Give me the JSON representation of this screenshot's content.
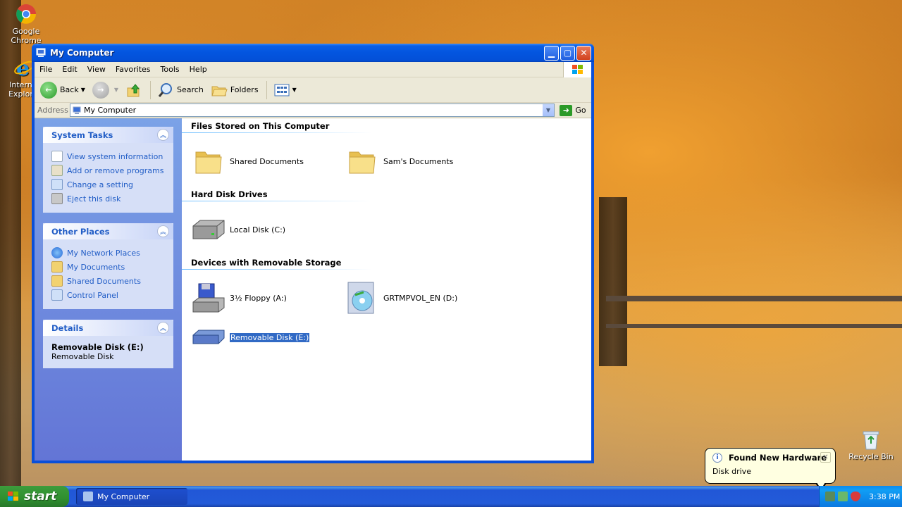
{
  "desktop": {
    "icons": [
      {
        "label": "Google Chrome",
        "icon": "chrome-icon"
      },
      {
        "label": "Internet Explorer",
        "icon": "ie-icon"
      },
      {
        "label": "Recycle Bin",
        "icon": "recycle-bin-icon"
      }
    ]
  },
  "window": {
    "title": "My Computer",
    "menu": [
      "File",
      "Edit",
      "View",
      "Favorites",
      "Tools",
      "Help"
    ],
    "toolbar": {
      "back": "Back",
      "search": "Search",
      "folders": "Folders"
    },
    "address": {
      "label": "Address",
      "value": "My Computer",
      "go": "Go"
    }
  },
  "sidebar": {
    "system_tasks": {
      "title": "System Tasks",
      "links": [
        "View system information",
        "Add or remove programs",
        "Change a setting",
        "Eject this disk"
      ]
    },
    "other_places": {
      "title": "Other Places",
      "links": [
        "My Network Places",
        "My Documents",
        "Shared Documents",
        "Control Panel"
      ]
    },
    "details": {
      "title": "Details",
      "name": "Removable Disk (E:)",
      "type": "Removable Disk"
    }
  },
  "content": {
    "groups": [
      {
        "title": "Files Stored on This Computer",
        "items": [
          "Shared Documents",
          "Sam's Documents"
        ]
      },
      {
        "title": "Hard Disk Drives",
        "items": [
          "Local Disk (C:)"
        ]
      },
      {
        "title": "Devices with Removable Storage",
        "items": [
          "3½ Floppy (A:)",
          "GRTMPVOL_EN (D:)",
          "Removable Disk (E:)"
        ]
      }
    ]
  },
  "taskbar": {
    "start": "start",
    "task": "My Computer",
    "clock": "3:38 PM"
  },
  "balloon": {
    "title": "Found New Hardware",
    "body": "Disk drive"
  },
  "colors": {
    "xp_blue": "#0355df",
    "link_blue": "#215dc6",
    "selection": "#316ac5",
    "start_green": "#2f8f2f"
  }
}
